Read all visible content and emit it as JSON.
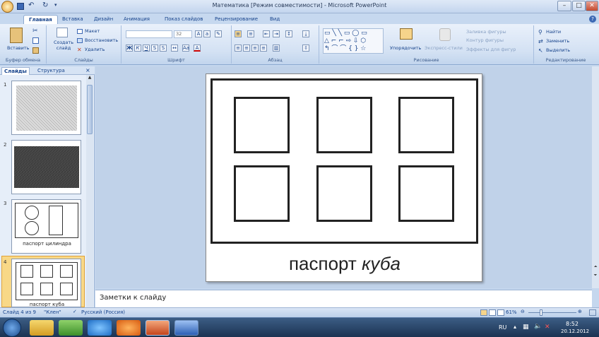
{
  "window": {
    "title": "Математика [Режим совместимости] - Microsoft PowerPoint"
  },
  "tabs": [
    "Главная",
    "Вставка",
    "Дизайн",
    "Анимация",
    "Показ слайдов",
    "Рецензирование",
    "Вид"
  ],
  "ribbon": {
    "clipboard": {
      "paste": "Вставить",
      "label": "Буфер обмена"
    },
    "slides": {
      "create": "Создать слайд",
      "layout": "Макет",
      "reset": "Восстановить",
      "delete": "Удалить",
      "label": "Слайды"
    },
    "font": {
      "size": "32",
      "label": "Шрифт"
    },
    "paragraph": {
      "label": "Абзац"
    },
    "drawing": {
      "arrange": "Упорядочить",
      "quickstyles": "Экспресс-стили",
      "fill": "Заливка фигуры",
      "outline": "Контур фигуры",
      "effects": "Эффекты для фигур",
      "label": "Рисование"
    },
    "editing": {
      "find": "Найти",
      "replace": "Заменить",
      "select": "Выделить",
      "label": "Редактирование"
    }
  },
  "panel": {
    "tab_slides": "Слайды",
    "tab_outline": "Структура"
  },
  "thumbnails": [
    {
      "num": "1"
    },
    {
      "num": "2"
    },
    {
      "num": "3",
      "caption": "паспорт цилиндра"
    },
    {
      "num": "4",
      "caption": "паспорт куба"
    }
  ],
  "slide": {
    "caption_normal": "паспорт ",
    "caption_italic": "куба"
  },
  "notes": {
    "placeholder": "Заметки к слайду"
  },
  "status": {
    "slide": "Слайд 4 из 9",
    "theme": "\"Клен\"",
    "language": "Русский (Россия)",
    "zoom": "61%"
  },
  "taskbar": {
    "lang": "RU",
    "time": "8:52",
    "date": "20.12.2012"
  }
}
